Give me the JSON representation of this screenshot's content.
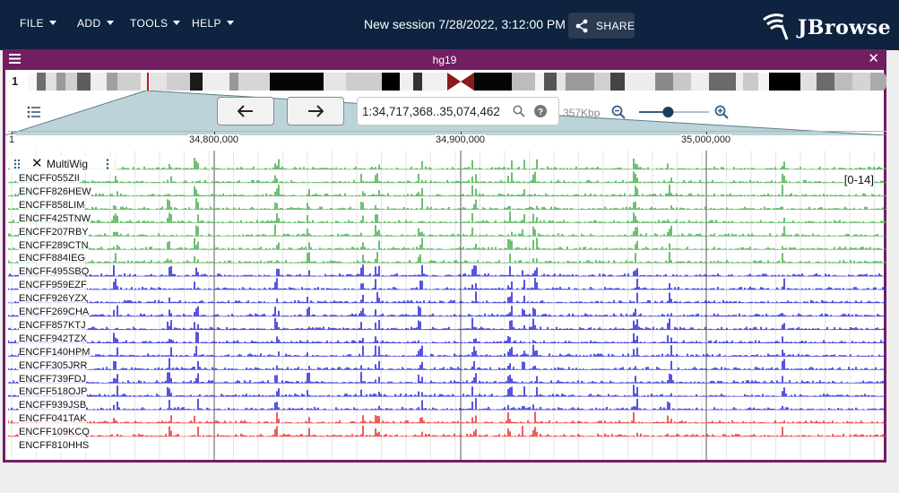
{
  "menu": {
    "file": "FILE",
    "add": "ADD",
    "tools": "TOOLS",
    "help": "HELP"
  },
  "session": {
    "title": "New session 7/28/2022, 3:12:00 PM",
    "share_label": "SHARE"
  },
  "brand": {
    "name": "JBrowse"
  },
  "view": {
    "title": "hg19",
    "chromosome": "1",
    "location": "1:34,717,368..35,074,462",
    "bp_per_view": "357Kbp",
    "zoom_level": 0.4
  },
  "ruler": {
    "labels": [
      "1",
      "34,800,000",
      "34,900,000",
      "35,000,000"
    ]
  },
  "track": {
    "name": "MultiWig",
    "scale": "[0-14]"
  },
  "rows": [
    {
      "label": "ENCFF055ZII",
      "color": "#4caf50"
    },
    {
      "label": "ENCFF826HEW",
      "color": "#4caf50"
    },
    {
      "label": "ENCFF858LIM",
      "color": "#4caf50"
    },
    {
      "label": "ENCFF425TNW",
      "color": "#4caf50"
    },
    {
      "label": "ENCFF207RBY",
      "color": "#4caf50"
    },
    {
      "label": "ENCFF289CTN",
      "color": "#4caf50"
    },
    {
      "label": "ENCFF884IEG",
      "color": "#4caf50"
    },
    {
      "label": "ENCFF495SBQ",
      "color": "#4caf50"
    },
    {
      "label": "ENCFF959EZF",
      "color": "#2b2bd6"
    },
    {
      "label": "ENCFF926YZX",
      "color": "#2b2bd6"
    },
    {
      "label": "ENCFF269CHA",
      "color": "#2b2bd6"
    },
    {
      "label": "ENCFF857KTJ",
      "color": "#2b2bd6"
    },
    {
      "label": "ENCFF942TZX",
      "color": "#2b2bd6"
    },
    {
      "label": "ENCFF140HPM",
      "color": "#2b2bd6"
    },
    {
      "label": "ENCFF305JRR",
      "color": "#2b2bd6"
    },
    {
      "label": "ENCFF739FDJ",
      "color": "#2b2bd6"
    },
    {
      "label": "ENCFF518OJP",
      "color": "#2b2bd6"
    },
    {
      "label": "ENCFF939JSB",
      "color": "#2b2bd6"
    },
    {
      "label": "ENCFF041TAK",
      "color": "#2b2bd6"
    },
    {
      "label": "ENCFF109KCQ",
      "color": "#e53935"
    },
    {
      "label": "ENCFF810HHS",
      "color": "#e53935"
    }
  ],
  "colors": {
    "appbar": "#0d233f",
    "view_header": "#721e63",
    "highlight": "#b71c1c"
  },
  "icons": {
    "menu": "hamburger-icon",
    "share": "share-icon",
    "close": "close-icon",
    "back": "arrow-left-icon",
    "forward": "arrow-right-icon",
    "search": "search-icon",
    "help": "help-icon",
    "zoom_out": "zoom-out-icon",
    "zoom_in": "zoom-in-icon",
    "track_list": "track-list-icon",
    "drag": "drag-handle-icon",
    "more": "more-vert-icon"
  }
}
